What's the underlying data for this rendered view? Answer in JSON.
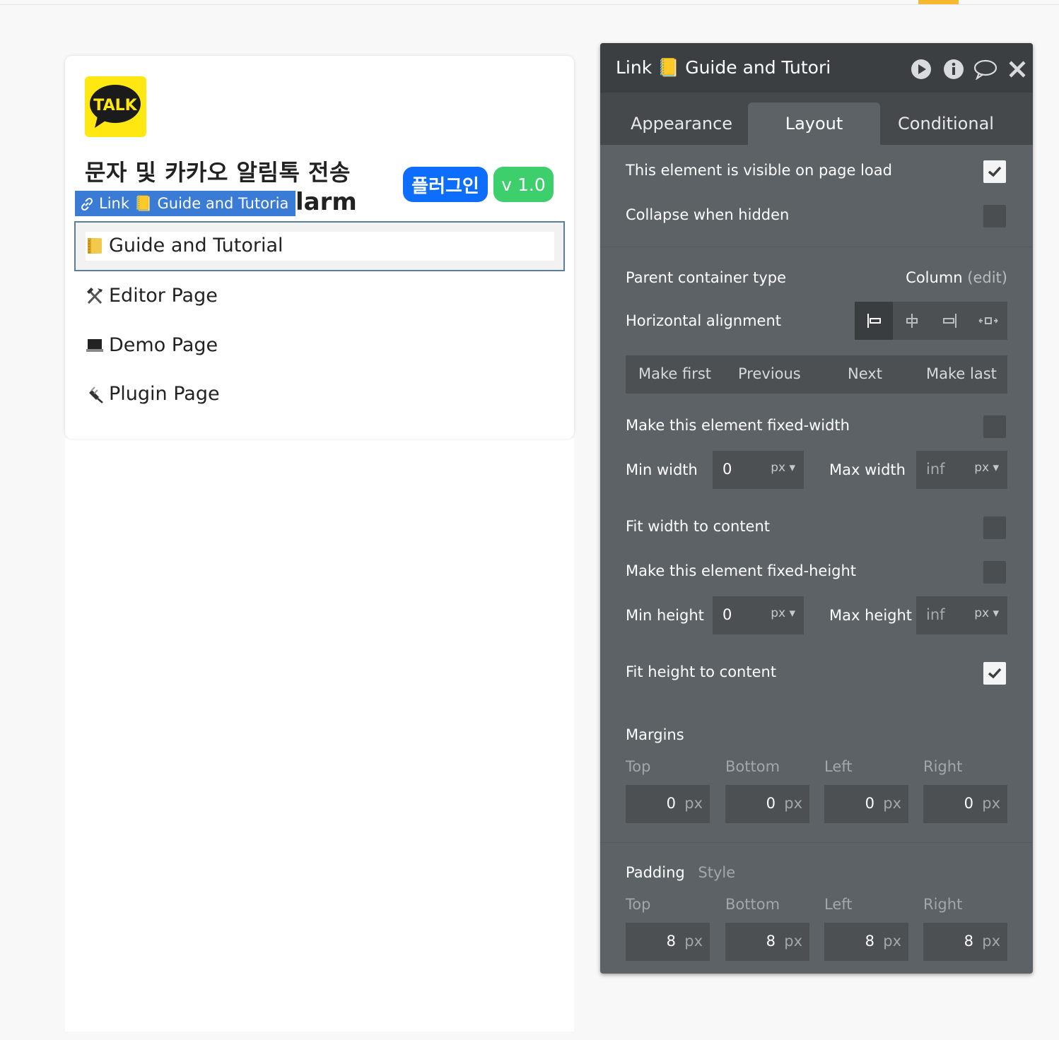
{
  "card": {
    "logo_text": "TALK",
    "title": "문자 및 카카오 알림톡 전송",
    "subtitle_tail": "larm",
    "plugin_badge": "플러그인",
    "version_badge": "v 1.0",
    "selection_tag": "Link 📒 Guide and Tutoria",
    "nav_items": [
      {
        "label": "Guide and Tutorial",
        "icon": "notebook-icon"
      },
      {
        "label": "Editor Page",
        "icon": "hammer-pick-icon"
      },
      {
        "label": "Demo Page",
        "icon": "laptop-icon"
      },
      {
        "label": "Plugin Page",
        "icon": "plug-icon"
      }
    ]
  },
  "panel": {
    "title": "Link 📒 Guide and Tutori",
    "tabs": [
      "Appearance",
      "Layout",
      "Conditional"
    ],
    "active_tab": "Layout",
    "visible_on_load": {
      "label": "This element is visible on page load",
      "checked": true
    },
    "collapse_hidden": {
      "label": "Collapse when hidden",
      "checked": false
    },
    "parent_container": {
      "label": "Parent container type",
      "value": "Column",
      "edit": "(edit)"
    },
    "horizontal_alignment": {
      "label": "Horizontal alignment",
      "selected": "left"
    },
    "order_buttons": [
      "Make first",
      "Previous",
      "Next",
      "Make last"
    ],
    "fixed_width": {
      "label": "Make this element fixed-width",
      "checked": false
    },
    "min_width": {
      "label": "Min width",
      "value": "0",
      "unit": "px"
    },
    "max_width": {
      "label": "Max width",
      "value": "inf",
      "unit": "px"
    },
    "fit_width": {
      "label": "Fit width to content",
      "checked": false
    },
    "fixed_height": {
      "label": "Make this element fixed-height",
      "checked": false
    },
    "min_height": {
      "label": "Min height",
      "value": "0",
      "unit": "px"
    },
    "max_height": {
      "label": "Max height",
      "value": "inf",
      "unit": "px"
    },
    "fit_height": {
      "label": "Fit height to content",
      "checked": true
    },
    "margins": {
      "label": "Margins",
      "sides": [
        "Top",
        "Bottom",
        "Left",
        "Right"
      ],
      "values": [
        "0",
        "0",
        "0",
        "0"
      ],
      "unit": "px"
    },
    "padding": {
      "label": "Padding",
      "style_link": "Style",
      "sides": [
        "Top",
        "Bottom",
        "Left",
        "Right"
      ],
      "values": [
        "8",
        "8",
        "8",
        "8"
      ],
      "unit": "px"
    }
  }
}
